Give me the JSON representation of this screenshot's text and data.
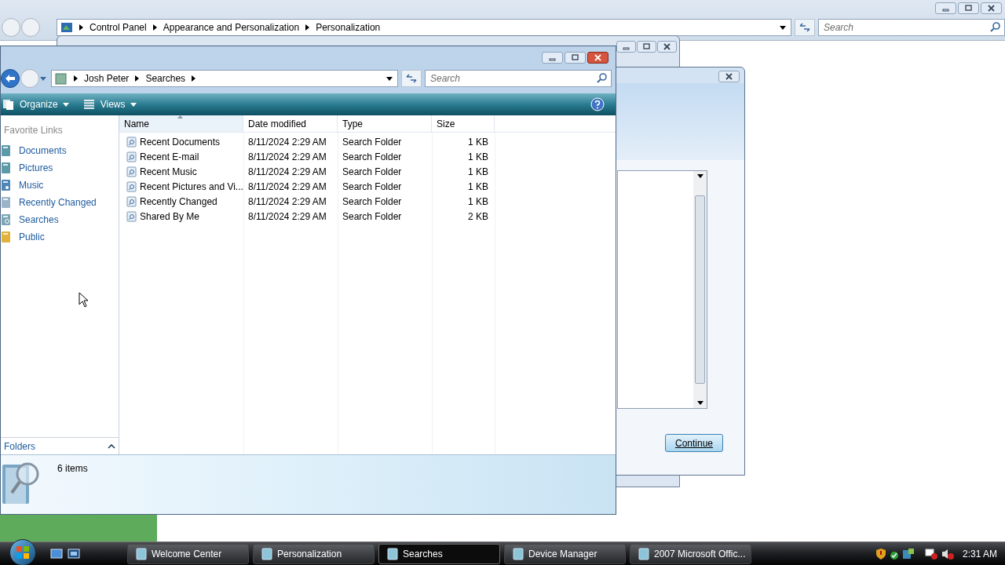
{
  "background_window": {
    "address": [
      "Control Panel",
      "Appearance and Personalization",
      "Personalization"
    ],
    "search_placeholder": "Search"
  },
  "dialog": {
    "button": "Continue"
  },
  "explorer": {
    "breadcrumb": [
      "Josh Peter",
      "Searches"
    ],
    "search_placeholder": "Search",
    "toolbar": [
      "Organize",
      "Views"
    ],
    "favorites_title": "Favorite Links",
    "favorites": [
      {
        "label": "Documents",
        "kind": "documents"
      },
      {
        "label": "Pictures",
        "kind": "pictures"
      },
      {
        "label": "Music",
        "kind": "music"
      },
      {
        "label": "Recently Changed",
        "kind": "recent"
      },
      {
        "label": "Searches",
        "kind": "searches"
      },
      {
        "label": "Public",
        "kind": "public"
      }
    ],
    "columns": [
      {
        "label": "Name",
        "sorted": true
      },
      {
        "label": "Date modified",
        "sorted": false
      },
      {
        "label": "Type",
        "sorted": false
      },
      {
        "label": "Size",
        "sorted": false
      }
    ],
    "rows": [
      {
        "name": "Recent Documents",
        "date": "8/11/2024 2:29 AM",
        "type": "Search Folder",
        "size": "1 KB"
      },
      {
        "name": "Recent E-mail",
        "date": "8/11/2024 2:29 AM",
        "type": "Search Folder",
        "size": "1 KB"
      },
      {
        "name": "Recent Music",
        "date": "8/11/2024 2:29 AM",
        "type": "Search Folder",
        "size": "1 KB"
      },
      {
        "name": "Recent Pictures and Vi...",
        "date": "8/11/2024 2:29 AM",
        "type": "Search Folder",
        "size": "1 KB"
      },
      {
        "name": "Recently Changed",
        "date": "8/11/2024 2:29 AM",
        "type": "Search Folder",
        "size": "1 KB"
      },
      {
        "name": "Shared By Me",
        "date": "8/11/2024 2:29 AM",
        "type": "Search Folder",
        "size": "2 KB"
      }
    ],
    "folders": "Folders",
    "status": "6 items"
  },
  "taskbar": {
    "buttons": [
      {
        "label": "Welcome Center",
        "selected": false
      },
      {
        "label": "Personalization",
        "selected": false
      },
      {
        "label": "Searches",
        "selected": true
      },
      {
        "label": "Device Manager",
        "selected": false
      },
      {
        "label": "2007 Microsoft Offic...",
        "selected": false
      }
    ],
    "clock": "2:31 AM"
  }
}
